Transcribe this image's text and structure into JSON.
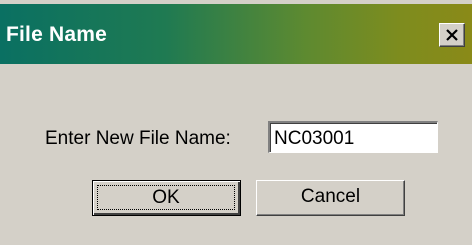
{
  "window": {
    "title": "File Name",
    "close_icon": "close-x-icon"
  },
  "form": {
    "prompt_label": "Enter New File Name:",
    "file_name_value": "NC03001"
  },
  "buttons": {
    "ok_label": "OK",
    "cancel_label": "Cancel"
  },
  "colors": {
    "dialog_face": "#d4d0c8",
    "titlebar_gradient_start": "#0a7062",
    "titlebar_gradient_end": "#8a8a18",
    "title_text": "#ffffff"
  }
}
